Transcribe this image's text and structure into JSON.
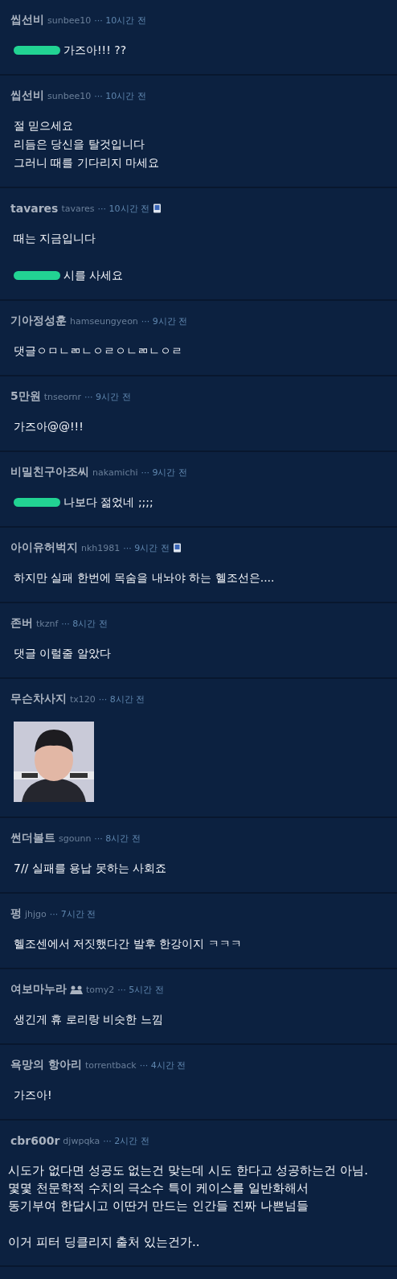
{
  "comments": [
    {
      "nickname": "씹선비",
      "user_id": "sunbee10",
      "time": "··· 10시간 전",
      "mobile": false,
      "badge": false,
      "kind": "plain",
      "paragraphs": [
        [
          {
            "text": "가즈아!!! ??",
            "censored": true
          }
        ]
      ]
    },
    {
      "nickname": "씹선비",
      "user_id": "sunbee10",
      "time": "··· 10시간 전",
      "mobile": false,
      "badge": false,
      "kind": "plain",
      "paragraphs": [
        [
          {
            "text": "절 믿으세요",
            "censored": false
          },
          {
            "text": "리듬은 당신을 탈것입니다",
            "censored": false
          },
          {
            "text": "그러니 때를 기다리지 마세요",
            "censored": false
          }
        ]
      ]
    },
    {
      "nickname": "tavares",
      "user_id": "tavares",
      "time": "··· 10시간 전",
      "mobile": true,
      "badge": false,
      "kind": "plain",
      "paragraphs": [
        [
          {
            "text": "때는 지금입니다",
            "censored": false
          }
        ],
        [
          {
            "text": "시를 사세요",
            "censored": true
          }
        ]
      ]
    },
    {
      "nickname": "기아정성훈",
      "user_id": "hamseungyeon",
      "time": "··· 9시간 전",
      "mobile": false,
      "badge": false,
      "kind": "plain",
      "paragraphs": [
        [
          {
            "text": "댓글ㅇㅁㄴㄻㄴㅇㄹㅇㄴㄻㄴㅇㄹ",
            "censored": false
          }
        ]
      ]
    },
    {
      "nickname": "5만원",
      "user_id": "tnseornr",
      "time": "··· 9시간 전",
      "mobile": false,
      "badge": false,
      "kind": "plain",
      "paragraphs": [
        [
          {
            "text": "가즈아@@!!!",
            "censored": false
          }
        ]
      ]
    },
    {
      "nickname": "비밀친구아조씨",
      "user_id": "nakamichi",
      "time": "··· 9시간 전",
      "mobile": false,
      "badge": false,
      "kind": "plain",
      "paragraphs": [
        [
          {
            "text": "나보다 젊었네 ;;;;",
            "censored": true
          }
        ]
      ]
    },
    {
      "nickname": "아이유허벅지",
      "user_id": "nkh1981",
      "time": "··· 9시간 전",
      "mobile": true,
      "badge": false,
      "kind": "plain",
      "paragraphs": [
        [
          {
            "text": "하지만 실패 한번에 목숨을 내놔야 하는 헬조선은....",
            "censored": false
          }
        ]
      ]
    },
    {
      "nickname": "존버",
      "user_id": "tkznf",
      "time": "··· 8시간 전",
      "mobile": false,
      "badge": false,
      "kind": "plain",
      "paragraphs": [
        [
          {
            "text": "댓글 이럴줄 알았다",
            "censored": false
          }
        ]
      ]
    },
    {
      "nickname": "무슨차사지",
      "user_id": "tx120",
      "time": "··· 8시간 전",
      "mobile": false,
      "badge": false,
      "kind": "picture"
    },
    {
      "nickname": "썬더볼트",
      "user_id": "sgounn",
      "time": "··· 8시간 전",
      "mobile": false,
      "badge": false,
      "kind": "plain",
      "paragraphs": [
        [
          {
            "text": "7// 실패를 용납 못하는 사회죠",
            "censored": false
          }
        ]
      ]
    },
    {
      "nickname": "펑",
      "user_id": "jhjgo",
      "time": "··· 7시간 전",
      "mobile": false,
      "badge": false,
      "kind": "plain",
      "paragraphs": [
        [
          {
            "text": "헬조센에서 저짓했다간 발후 한강이지 ㅋㅋㅋ",
            "censored": false
          }
        ]
      ]
    },
    {
      "nickname": "여보마누라",
      "user_id": "tomy2",
      "time": "··· 5시간 전",
      "mobile": false,
      "badge": true,
      "kind": "plain",
      "paragraphs": [
        [
          {
            "text": "생긴게 휴 로리랑 비슷한 느낌",
            "censored": false
          }
        ]
      ]
    },
    {
      "nickname": "욕망의 항아리",
      "user_id": "torrentback",
      "time": "··· 4시간 전",
      "mobile": false,
      "badge": false,
      "kind": "plain",
      "paragraphs": [
        [
          {
            "text": "가즈아!",
            "censored": false
          }
        ]
      ]
    },
    {
      "nickname": "cbr600r",
      "user_id": "djwpqka",
      "time": "··· 2시간 전",
      "mobile": false,
      "badge": false,
      "kind": "wide",
      "paragraphs": [
        [
          {
            "text": "시도가 없다면 성공도 없는건 맞는데 시도 한다고 성공하는건 아님.",
            "censored": false
          },
          {
            "text": "몇몇 천문학적 수치의 극소수 특이 케이스를 일반화해서",
            "censored": false
          },
          {
            "text": "동기부여 한답시고 이딴거 만드는 인간들 진짜 나쁜넘들",
            "censored": false
          }
        ],
        [
          {
            "text": "이거 피터 딩클리지 출처 있는건가..",
            "censored": false
          }
        ]
      ]
    }
  ]
}
